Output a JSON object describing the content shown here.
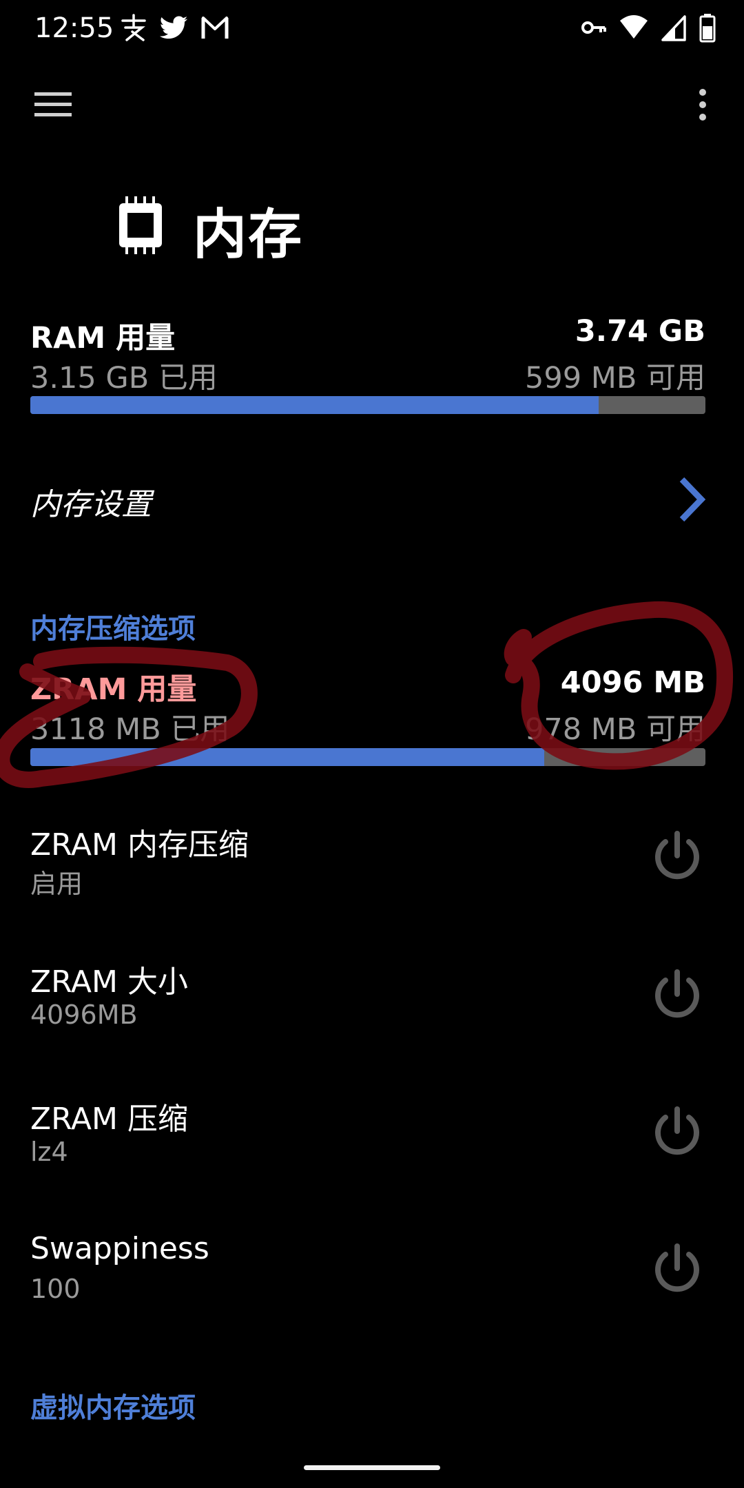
{
  "status_bar": {
    "time": "12:55",
    "left_icons": [
      "alipay-icon",
      "twitter-icon",
      "gmail-icon"
    ],
    "right_icons": [
      "vpn-key-icon",
      "wifi-icon",
      "cell-signal-icon",
      "battery-icon"
    ]
  },
  "toolbar": {
    "menu_icon": "hamburger-menu-icon",
    "more_icon": "more-vert-icon"
  },
  "header": {
    "title": "内存",
    "icon": "memory-chip-icon"
  },
  "ram": {
    "label": "RAM 用量",
    "total": "3.74 GB",
    "used": "3.15 GB 已用",
    "free": "599 MB 可用",
    "used_fraction": 0.842
  },
  "settings_link": {
    "label": "内存设置",
    "icon": "chevron-right-icon"
  },
  "zram_section": {
    "header": "内存压缩选项"
  },
  "zram": {
    "label": "ZRAM 用量",
    "total": "4096 MB",
    "used": "3118 MB 已用",
    "free": "978 MB 可用",
    "used_fraction": 0.761
  },
  "items": [
    {
      "title": "ZRAM 内存压缩",
      "value": "启用"
    },
    {
      "title": "ZRAM 大小",
      "value": "4096MB"
    },
    {
      "title": "ZRAM 压缩",
      "value": "lz4"
    },
    {
      "title": "Swappiness",
      "value": "100"
    }
  ],
  "vm_section": {
    "header": "虚拟内存选项"
  },
  "colors": {
    "accent": "#4a76d1",
    "section_header": "#4f7fd8",
    "bar_track": "#5f5f5f",
    "secondary_text": "#9a9a9a",
    "annotation_red": "#7a0d14"
  }
}
